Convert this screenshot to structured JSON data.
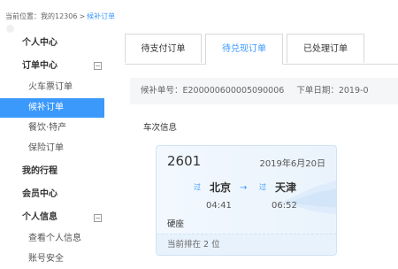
{
  "breadcrumb": {
    "prefix": "当前位置：",
    "root": "我的12306",
    "separator": ">",
    "current": "候补订单"
  },
  "sidebar": {
    "personal_center": "个人中心",
    "order_center": "订单中心",
    "order_items": [
      "火车票订单",
      "候补订单",
      "餐饮·特产",
      "保险订单"
    ],
    "my_trips": "我的行程",
    "member_center": "会员中心",
    "personal_info": "个人信息",
    "info_items": [
      "查看个人信息",
      "账号安全"
    ],
    "toggle_symbol": "−"
  },
  "tabs": [
    {
      "label": "待支付订单"
    },
    {
      "label": "待兑现订单"
    },
    {
      "label": "已处理订单"
    }
  ],
  "order": {
    "number_label": "候补单号：",
    "number": "E200000600005090006",
    "date_label": "下单日期：",
    "date": "2019-0"
  },
  "train_info_title": "车次信息",
  "train": {
    "number": "2601",
    "date": "2019年6月20日",
    "from_tag": "过",
    "from_station": "北京",
    "arrow": "→",
    "to_tag": "过",
    "to_station": "天津",
    "depart_time": "04:41",
    "arrive_time": "06:52",
    "seat": "硬座",
    "queue_prefix": "当前排在",
    "queue_position": "2",
    "queue_suffix": "位"
  },
  "colors": {
    "accent": "#3b99fc",
    "card_bg": "#eaf3fc",
    "border": "#d9d9d9"
  }
}
